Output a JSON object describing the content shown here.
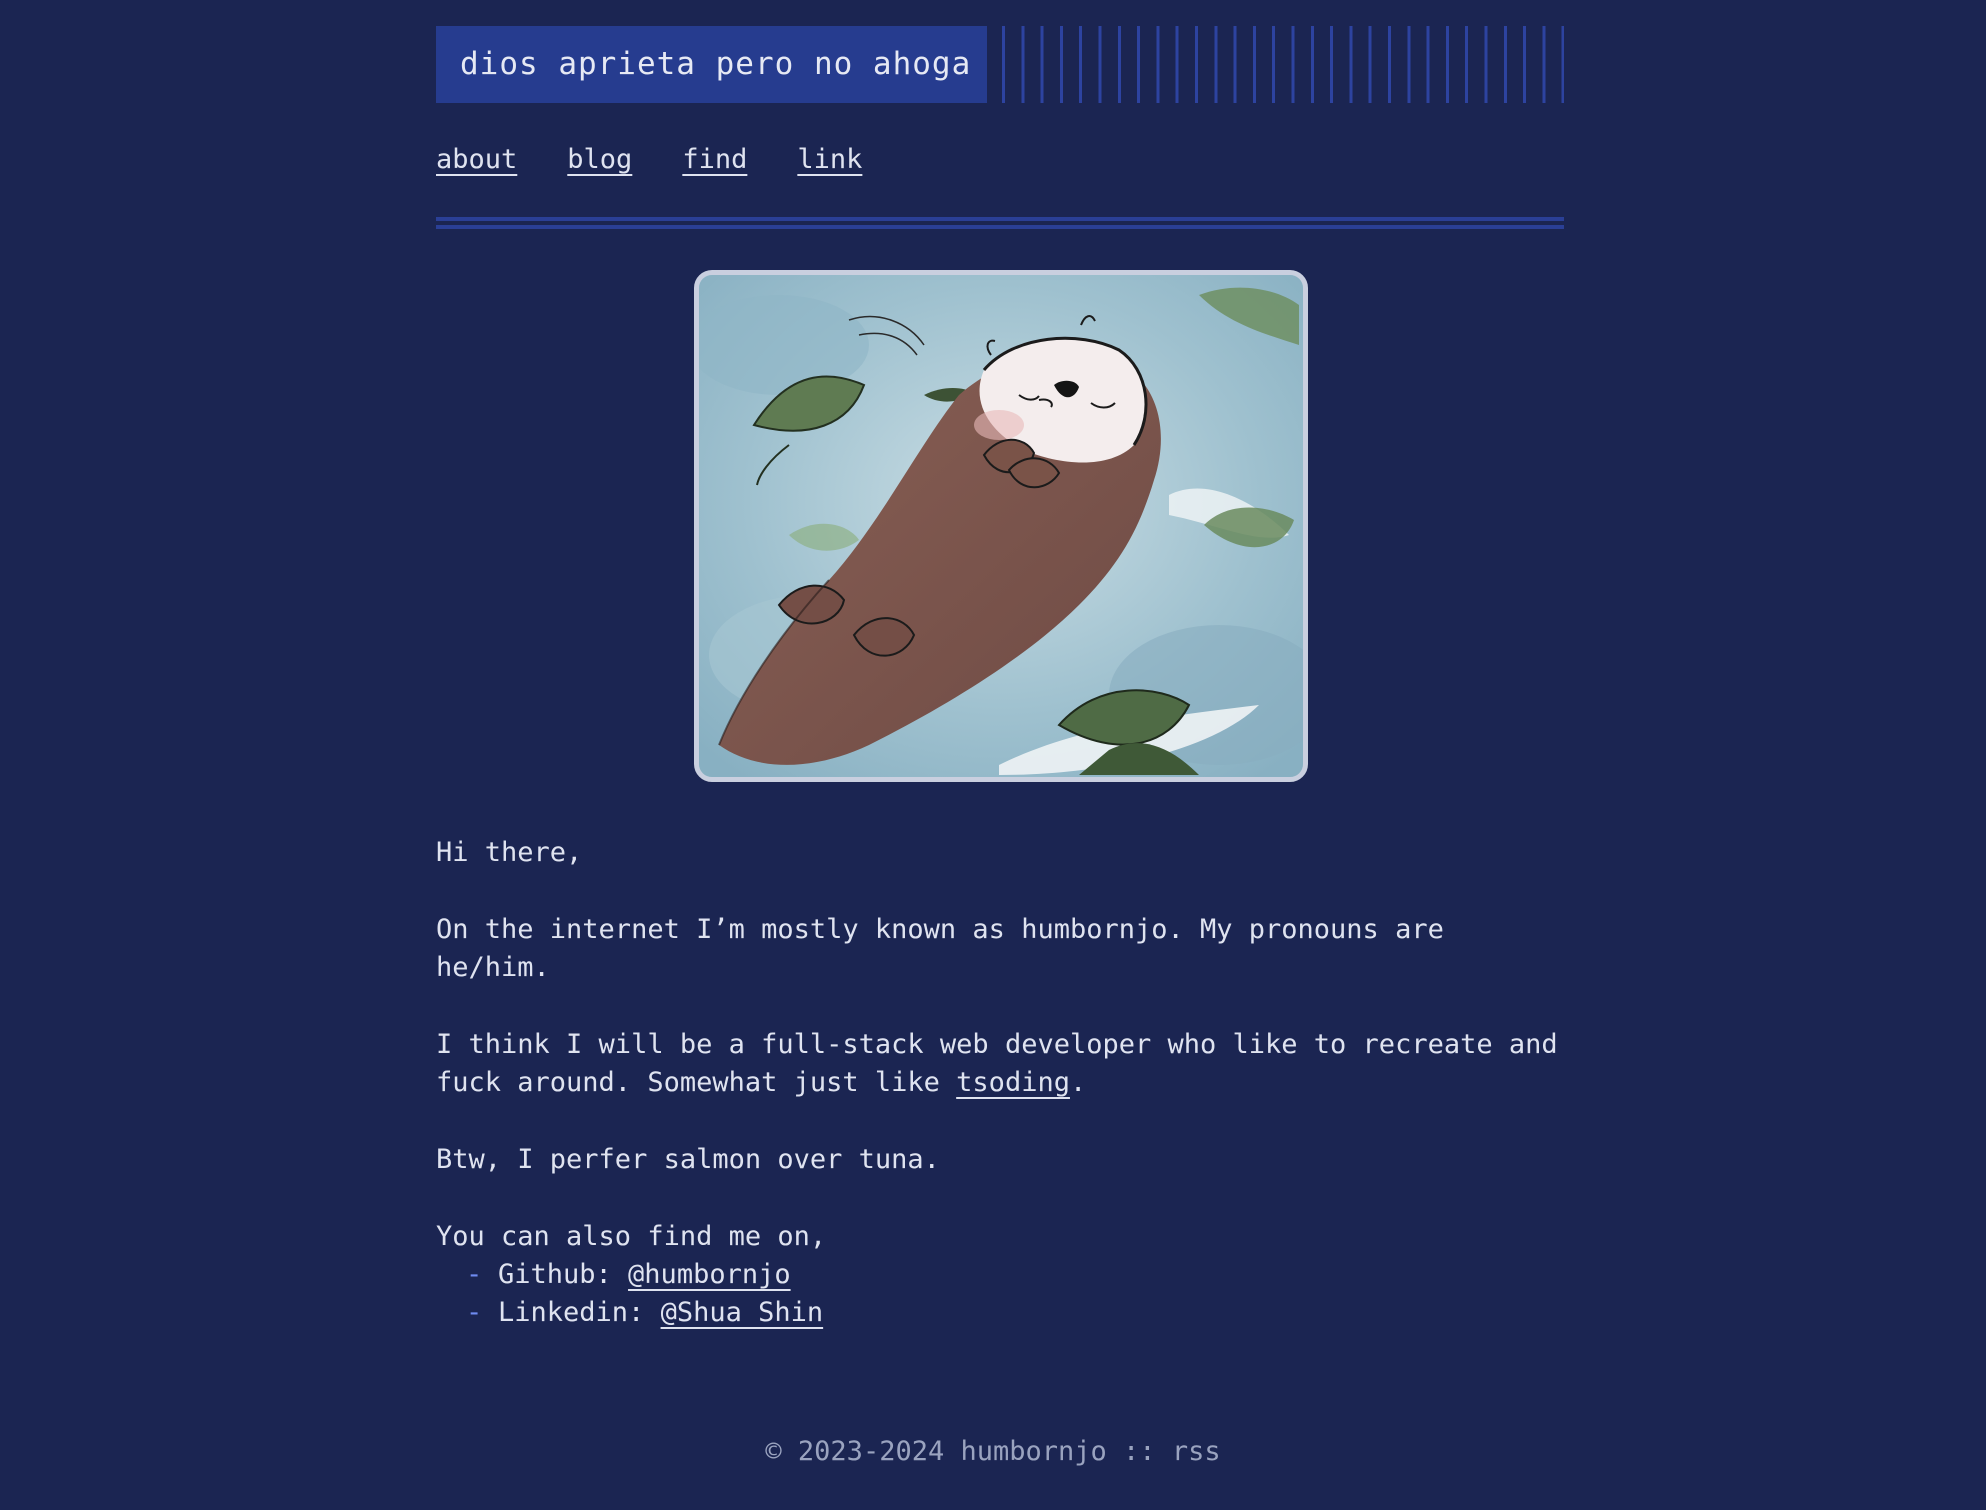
{
  "header": {
    "title": "dios aprieta pero no ahoga"
  },
  "nav": {
    "items": [
      {
        "label": "about"
      },
      {
        "label": "blog"
      },
      {
        "label": "find"
      },
      {
        "label": "link"
      }
    ]
  },
  "main": {
    "greeting": "Hi there,",
    "intro": "On the internet I’m mostly known as humbornjo. My pronouns are he/him.",
    "about_prefix": "I think I will be a full-stack web developer who like to recreate and fuck around. Somewhat just like ",
    "about_link": "tsoding",
    "about_suffix": ".",
    "btw": "Btw, I perfer salmon over tuna.",
    "find_intro": "You can also find me on,",
    "links": [
      {
        "bullet": "-",
        "label": "Github: ",
        "link": "@humbornjo"
      },
      {
        "bullet": "-",
        "label": "Linkedin: ",
        "link": "@Shua Shin"
      }
    ]
  },
  "footer": {
    "copyright": "© 2023-2024 humbornjo",
    "separator": " :: ",
    "rss": "rss"
  },
  "colors": {
    "background": "#1b2552",
    "header_block": "#263c8f",
    "accent_bullet": "#6f8bf0",
    "text": "#dfe3f0",
    "footer_text": "#9aa3bf"
  }
}
